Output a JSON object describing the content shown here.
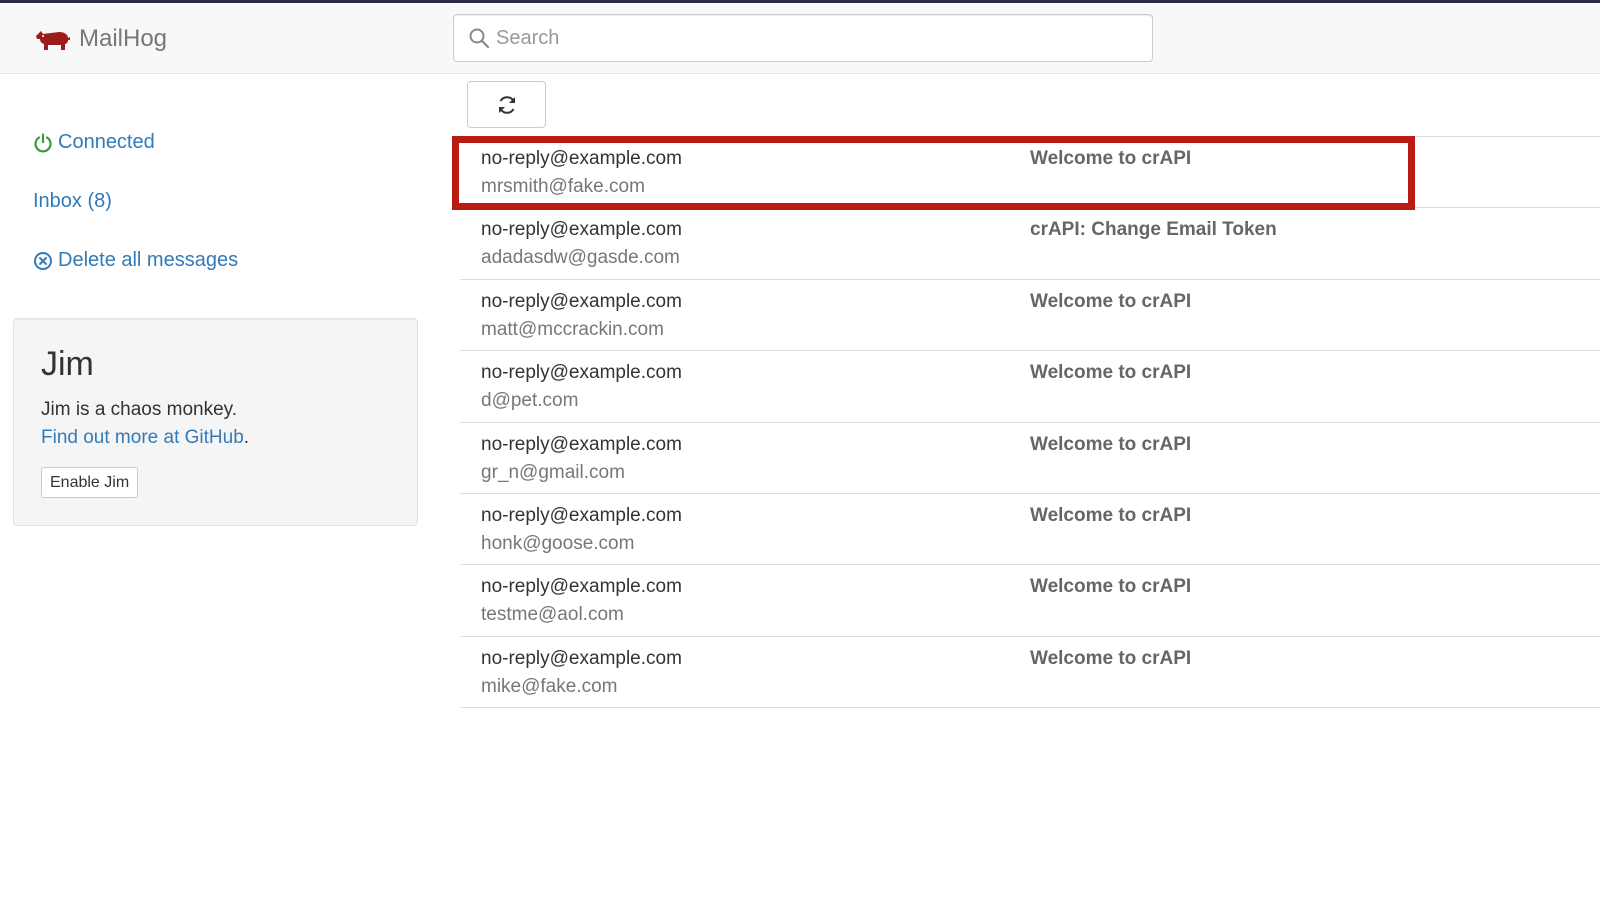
{
  "brand": {
    "name": "MailHog"
  },
  "search": {
    "placeholder": "Search",
    "value": ""
  },
  "toolbar": {
    "refresh_icon": "refresh-icon"
  },
  "sidebar": {
    "status": {
      "label": "Connected",
      "icon": "power-icon",
      "color": "#3c9a3c"
    },
    "inbox": {
      "label": "Inbox (8)"
    },
    "delete_all": {
      "label": "Delete all messages",
      "icon": "circle-x-icon"
    }
  },
  "jim": {
    "title": "Jim",
    "description": "Jim is a chaos monkey.",
    "more_link": "Find out more at GitHub",
    "more_suffix": ".",
    "enable_button": "Enable Jim"
  },
  "messages": [
    {
      "from": "no-reply@example.com",
      "to": "mrsmith@fake.com",
      "subject": "Welcome to crAPI",
      "highlighted": true
    },
    {
      "from": "no-reply@example.com",
      "to": "adadasdw@gasde.com",
      "subject": "crAPI: Change Email Token"
    },
    {
      "from": "no-reply@example.com",
      "to": "matt@mccrackin.com",
      "subject": "Welcome to crAPI"
    },
    {
      "from": "no-reply@example.com",
      "to": "d@pet.com",
      "subject": "Welcome to crAPI"
    },
    {
      "from": "no-reply@example.com",
      "to": "gr_n@gmail.com",
      "subject": "Welcome to crAPI"
    },
    {
      "from": "no-reply@example.com",
      "to": "honk@goose.com",
      "subject": "Welcome to crAPI"
    },
    {
      "from": "no-reply@example.com",
      "to": "testme@aol.com",
      "subject": "Welcome to crAPI"
    },
    {
      "from": "no-reply@example.com",
      "to": "mike@fake.com",
      "subject": "Welcome to crAPI"
    }
  ],
  "colors": {
    "link": "#337ab7",
    "highlight": "#b81c12",
    "brand_logo": "#9b1b1b"
  }
}
